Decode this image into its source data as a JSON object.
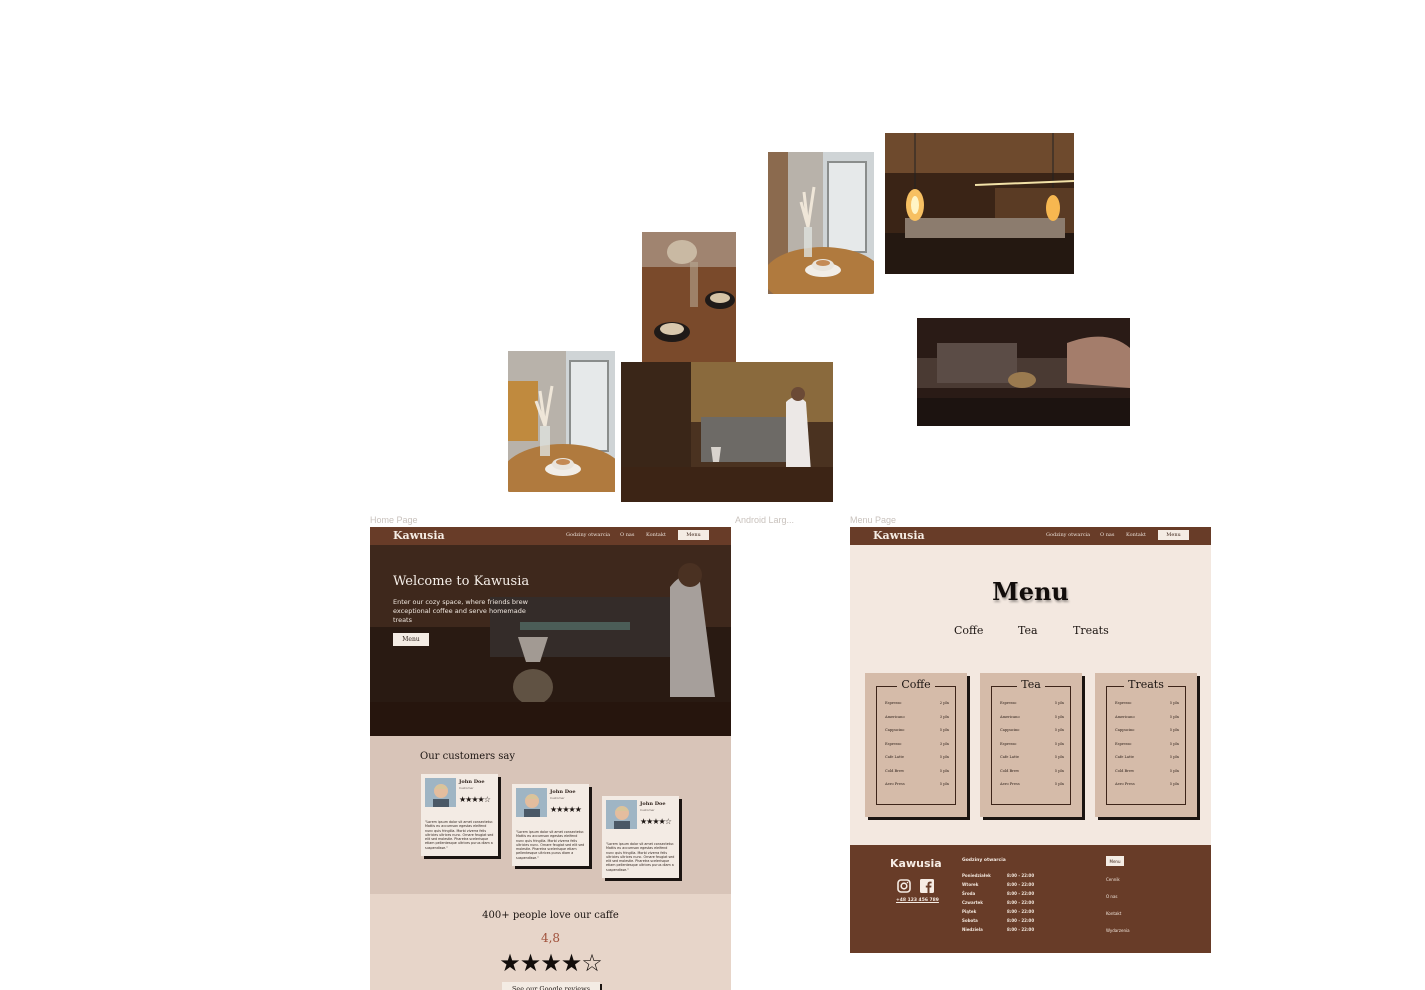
{
  "frames": {
    "home_label": "Home Page",
    "android_label": "Android Larg...",
    "menu_label": "Menu Page"
  },
  "nav": {
    "brand": "Kawusia",
    "links": [
      "Godziny otwarcia",
      "O nas",
      "Kontakt"
    ],
    "button": "Menu"
  },
  "hero": {
    "title": "Welcome to Kawusia",
    "subtitle": "Enter our cozy space, where friends brew exceptional coffee and serve homemade treats",
    "button": "Menu"
  },
  "customers": {
    "heading": "Our customers say",
    "reviews": [
      {
        "name": "John Doe",
        "role": "Customer",
        "stars": "★★★★☆",
        "rating": 4.5,
        "text": "\"Lorem ipsum dolor sit amet consectetur. Mattis eu accumsan egestas eleifend nunc quis fringilla. Morbi viverra felis ultricies ultrices nunc. Ornare feugiat sed elit sed molestie. Pharetra scelerisque etiam pellentesque ultrices purus diam a suspendisse.\""
      },
      {
        "name": "John Doe",
        "role": "Customer",
        "stars": "★★★★★",
        "rating": 5,
        "text": "\"Lorem ipsum dolor sit amet consectetur. Mattis eu accumsan egestas eleifend nunc quis fringilla. Morbi viverra felis ultricies nunc. Ornare feugiat sed elit sed molestie. Pharetra scelerisque etiam pellentesque ultrices purus diam a suspendisse.\""
      },
      {
        "name": "John Doe",
        "role": "Customer",
        "stars": "★★★★☆",
        "rating": 4.5,
        "text": "\"Lorem ipsum dolor sit amet consectetur. Mattis eu accumsan egestas eleifend nunc quis fringilla. Morbi viverra felis ultricies ultrices nunc. Ornare feugiat sed elit sed molestie. Pharetra scelerisque etiam pellentesque ultrices purus diam a suspendisse.\""
      }
    ]
  },
  "rating": {
    "heading": "400+ people love our caffe",
    "score": "4,8",
    "stars": "★★★★☆",
    "button": "See our Google reviews"
  },
  "menu_page": {
    "title": "Menu",
    "tabs": [
      "Coffe",
      "Tea",
      "Treats"
    ],
    "cards": [
      {
        "title": "Coffe",
        "items": [
          {
            "name": "Espresso",
            "price": "2 pln"
          },
          {
            "name": "Americano",
            "price": "3 pln"
          },
          {
            "name": "Cappucino",
            "price": "5 pln"
          },
          {
            "name": "Espresso",
            "price": "3 pln"
          },
          {
            "name": "Cafe Latte",
            "price": "5 pln"
          },
          {
            "name": "Cold Brew",
            "price": "5 pln"
          },
          {
            "name": "Aero Press",
            "price": "5 pln"
          }
        ]
      },
      {
        "title": "Tea",
        "items": [
          {
            "name": "Espresso",
            "price": "5 pln"
          },
          {
            "name": "Americano",
            "price": "5 pln"
          },
          {
            "name": "Cappucino",
            "price": "5 pln"
          },
          {
            "name": "Espresso",
            "price": "5 pln"
          },
          {
            "name": "Cafe Latte",
            "price": "5 pln"
          },
          {
            "name": "Cold Brew",
            "price": "5 pln"
          },
          {
            "name": "Aero Press",
            "price": "5 pln"
          }
        ]
      },
      {
        "title": "Treats",
        "items": [
          {
            "name": "Espresso",
            "price": "5 pln"
          },
          {
            "name": "Americano",
            "price": "5 pln"
          },
          {
            "name": "Cappucino",
            "price": "5 pln"
          },
          {
            "name": "Espresso",
            "price": "5 pln"
          },
          {
            "name": "Cafe Latte",
            "price": "5 pln"
          },
          {
            "name": "Cold Brew",
            "price": "5 pln"
          },
          {
            "name": "Aero Press",
            "price": "5 pln"
          }
        ]
      }
    ]
  },
  "footer": {
    "brand": "Kawusia",
    "phone": "+48 123 456 789",
    "hours_title": "Godziny otwarcia",
    "hours": [
      {
        "day": "Poniedziałek",
        "time": "8:00 - 22:00"
      },
      {
        "day": "Wtorek",
        "time": "8:00 - 22:00"
      },
      {
        "day": "Środa",
        "time": "8:00 - 22:00"
      },
      {
        "day": "Czwartek",
        "time": "8:00 - 22:00"
      },
      {
        "day": "Piątek",
        "time": "8:00 - 22:00"
      },
      {
        "day": "Sobota",
        "time": "8:00 - 22:00"
      },
      {
        "day": "Niedziela",
        "time": "8:00 - 22:00"
      }
    ],
    "menu_button": "Menu",
    "links": [
      "Cennik",
      "O nas",
      "Kontakt",
      "Wydarzenia"
    ]
  },
  "colors": {
    "brown": "#683c28",
    "cream": "#f3e8e0",
    "tan": "#d5bba9",
    "accent": "#a0503a"
  }
}
